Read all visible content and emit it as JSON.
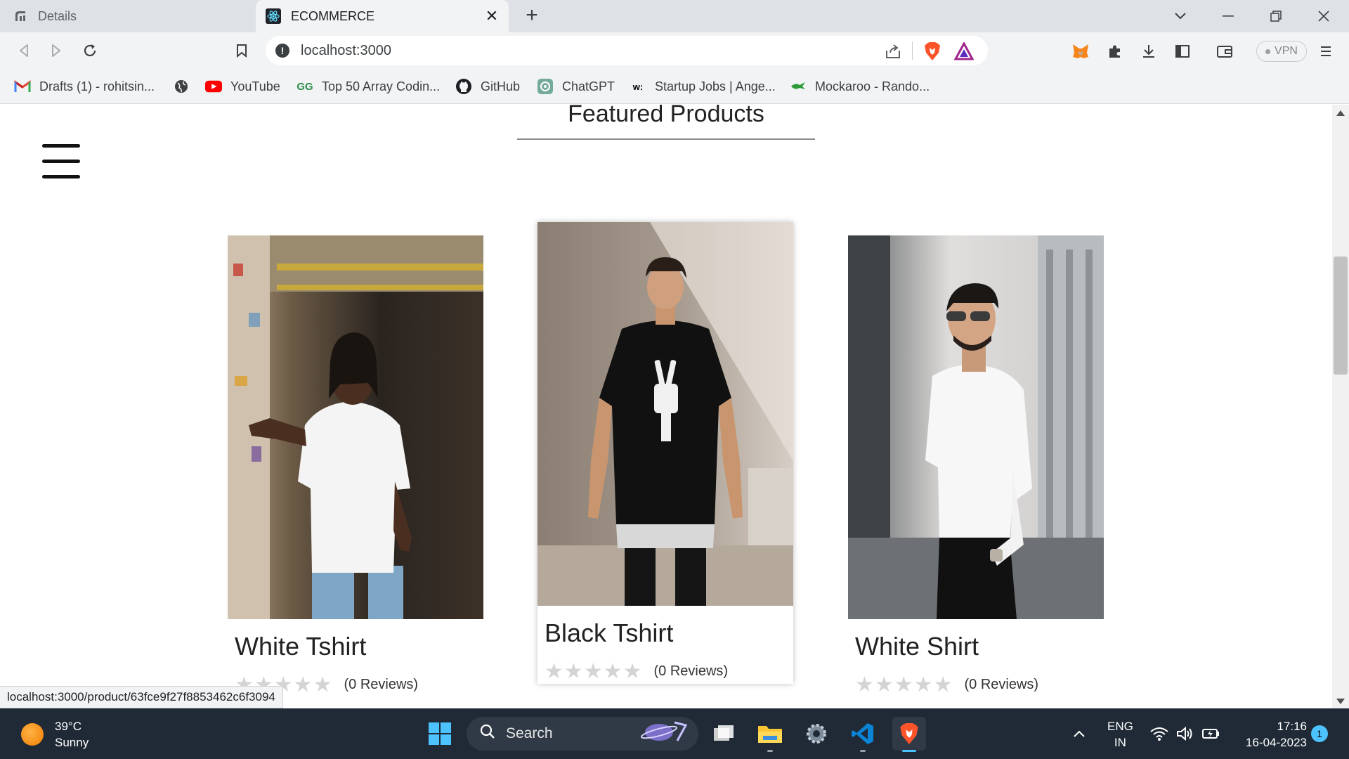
{
  "browser": {
    "tabs": [
      {
        "label": "Details",
        "active": false
      },
      {
        "label": "ECOMMERCE",
        "active": true
      }
    ],
    "address": "localhost:3000",
    "vpn_label": "VPN",
    "bookmarks": [
      {
        "label": "Drafts (1) - rohitsin...",
        "icon": "gmail-icon"
      },
      {
        "label": "",
        "icon": "globe-icon"
      },
      {
        "label": "YouTube",
        "icon": "youtube-icon"
      },
      {
        "label": "Top 50 Array Codin...",
        "icon": "geeksforgeeks-icon"
      },
      {
        "label": "GitHub",
        "icon": "github-icon"
      },
      {
        "label": "ChatGPT",
        "icon": "chatgpt-icon"
      },
      {
        "label": "Startup Jobs | Ange...",
        "icon": "wellfound-icon"
      },
      {
        "label": "Mockaroo - Rando...",
        "icon": "mockaroo-icon"
      }
    ],
    "status_url": "localhost:3000/product/63fce9f27f8853462c6f3094"
  },
  "page": {
    "heading": "Featured Products",
    "products": [
      {
        "name": "White Tshirt",
        "reviews": "(0 Reviews)",
        "rating": 0,
        "hovered": false
      },
      {
        "name": "Black Tshirt",
        "reviews": "(0 Reviews)",
        "rating": 0,
        "hovered": true
      },
      {
        "name": "White Shirt",
        "reviews": "(0 Reviews)",
        "rating": 0,
        "hovered": false
      }
    ]
  },
  "taskbar": {
    "temperature": "39°C",
    "condition": "Sunny",
    "search_label": "Search",
    "lang_top": "ENG",
    "lang_bottom": "IN",
    "time": "17:16",
    "date": "16-04-2023",
    "notification_count": "1"
  },
  "colors": {
    "taskbar_bg": "#1f2a36",
    "tabbar_bg": "#dee1e6",
    "toolbar_bg": "#f1f3f4",
    "star_empty": "#d4d4d4"
  }
}
